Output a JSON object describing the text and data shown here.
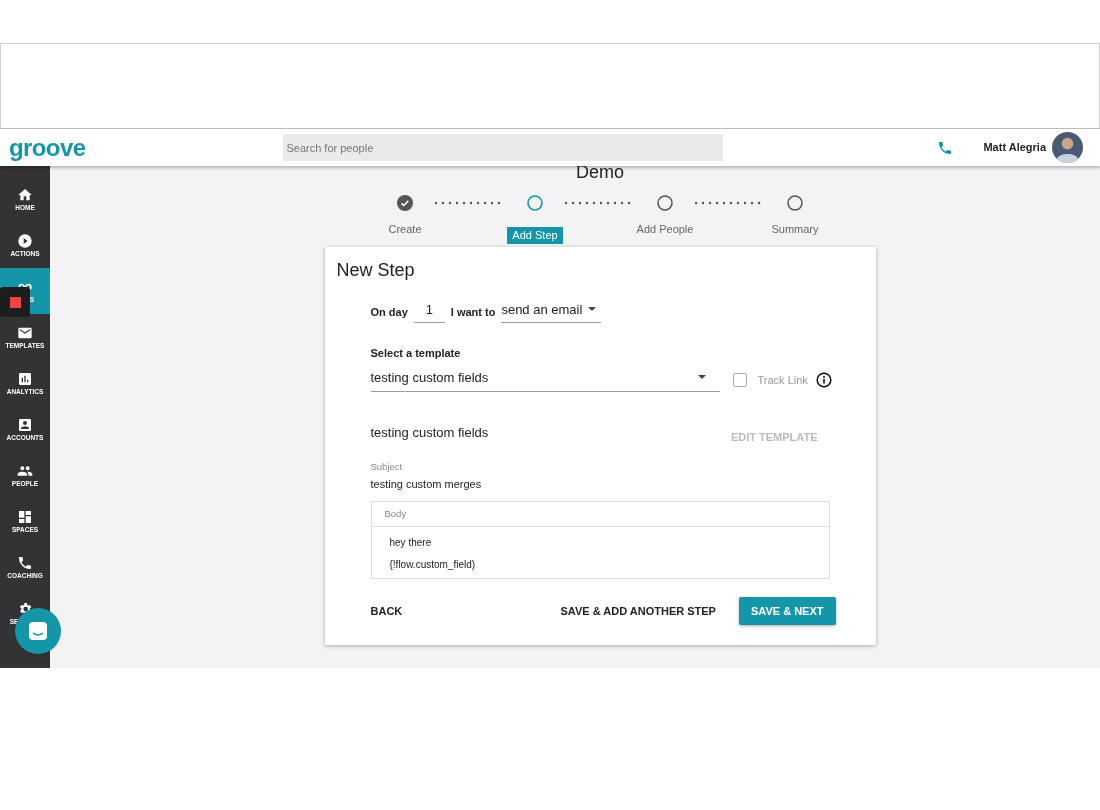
{
  "header": {
    "logo": "groove",
    "search": {
      "placeholder": "Search for people"
    },
    "user": "Matt Alegria"
  },
  "sidebar": {
    "items": [
      {
        "label": "HOME",
        "selected": false
      },
      {
        "label": "ACTIONS",
        "selected": false
      },
      {
        "label": "S",
        "selected": true
      },
      {
        "label": "TEMPLATES",
        "selected": false
      },
      {
        "label": "ANALYTICS",
        "selected": false
      },
      {
        "label": "ACCOUNTS",
        "selected": false
      },
      {
        "label": "PEOPLE",
        "selected": false
      },
      {
        "label": "SPACES",
        "selected": false
      },
      {
        "label": "COACHING",
        "selected": false
      },
      {
        "label": "SE",
        "selected": false
      }
    ]
  },
  "page_title": "Demo",
  "stepper": [
    {
      "label": "Create",
      "completed": true,
      "selected": false
    },
    {
      "label": "Add Step",
      "completed": false,
      "selected": true
    },
    {
      "label": "Add People",
      "completed": false,
      "selected": false
    },
    {
      "label": "Summary",
      "completed": false,
      "selected": false
    }
  ],
  "card": {
    "title": "New Step",
    "day_label": "On day",
    "day_value": "1",
    "action_label": "I want to",
    "action_value": "send an email",
    "template_label": "Select a template",
    "template_value": "testing custom fields",
    "track_link": {
      "label": "Track Link",
      "checked": false
    },
    "template_name": "testing custom fields",
    "edit_template": "EDIT TEMPLATE",
    "subject_label": "Subject",
    "subject": "testing custom merges",
    "body_label": "Body",
    "body_lines": [
      "hey there",
      "{!flow.custom_field)"
    ],
    "buttons": [
      {
        "label": "BACK",
        "kind": "text"
      },
      {
        "label": "SAVE & ADD ANOTHER STEP",
        "kind": "text"
      },
      {
        "label": "SAVE & NEXT",
        "kind": "primary"
      }
    ]
  }
}
